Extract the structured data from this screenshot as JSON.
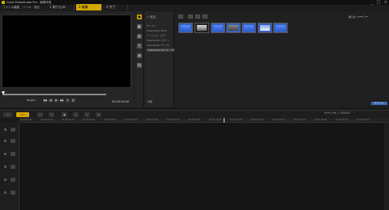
{
  "window": {
    "title": "Corel VideoStudio Pro - 新規作成",
    "controls": [
      "_",
      "□",
      "×"
    ]
  },
  "menu": [
    "ファイル",
    "編集",
    "ツール",
    "設定"
  ],
  "steps": [
    {
      "label": "1 取り込み",
      "active": false
    },
    {
      "label": "2 編集",
      "active": true
    },
    {
      "label": "3 完了",
      "active": false
    }
  ],
  "player": {
    "project_label": "Project",
    "timecode": "00:00:00:00",
    "controls": [
      "◀◀",
      "◀",
      "▶",
      "▶▶",
      "↻",
      "🔊"
    ]
  },
  "library": {
    "add_label": "+ 追加",
    "tree_items": [
      {
        "label": "サンプル",
        "selected": false
      },
      {
        "label": "VideoStudio 2019",
        "selected": false
      },
      {
        "label": "ベーシック・カラー",
        "selected": false
      },
      {
        "label": "VideoStudio パターン",
        "selected": false
      },
      {
        "label": "VideoStudio サンプル",
        "selected": false
      },
      {
        "label": "VideoStudio Pro サンプル",
        "selected": true
      }
    ],
    "browse_label": "参照",
    "options_label": "オプション"
  },
  "timeline": {
    "ruler_ticks": [
      "00:00:00:00",
      "00:00:02:00",
      "00:00:04:00",
      "00:00:06:00",
      "00:00:08:00",
      "00:00:10:00",
      "00:00:12:00",
      "00:00:14:00",
      "00:00:16:00",
      "00:00:18:00",
      "00:00:20:00",
      "00:00:22:00",
      "00:00:24:00",
      "00:00:26:00",
      "00:00:28:00",
      "00:00:30:00",
      "00:00:32:00"
    ],
    "zoom_label": "0:00:00:00"
  },
  "colors": {
    "accent": "#d4a800",
    "preview_bg": "#000000",
    "thumb_blue": "#3a60c0"
  }
}
